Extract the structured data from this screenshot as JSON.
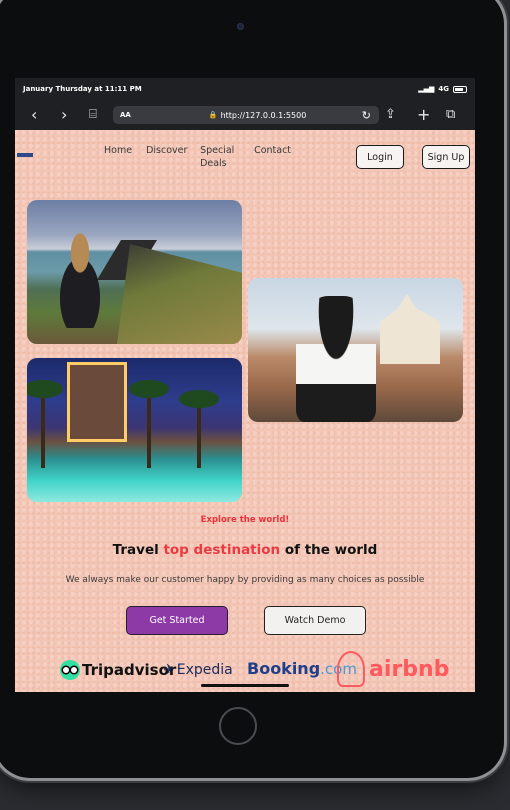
{
  "status_bar": {
    "datetime": "January Thursday at 11:11 PM",
    "signal": "4G"
  },
  "browser": {
    "text_size_label": "AA",
    "url": "http://127.0.0.1:5500",
    "icons": [
      "back-icon",
      "forward-icon",
      "bookmarks-icon",
      "lock-icon",
      "reload-icon",
      "share-icon",
      "new-tab-icon",
      "tabs-icon"
    ]
  },
  "nav": {
    "items": [
      {
        "label": "Home"
      },
      {
        "label": "Discover"
      },
      {
        "label": "Special Deals"
      },
      {
        "label": "Contact"
      }
    ],
    "login": "Login",
    "signup": "Sign Up"
  },
  "hero": {
    "tagline": "Explore the world!",
    "headline_prefix": "Travel ",
    "headline_accent": "top destination",
    "headline_suffix": " of the world",
    "subtitle": "We always make our customer happy by providing as many choices as possible",
    "primary_cta": "Get Started",
    "secondary_cta": "Watch Demo"
  },
  "partners": {
    "tripadvisor": "Tripadvisor",
    "expedia": "Expedia",
    "booking_main": "Booking",
    "booking_suffix": ".com",
    "airbnb": "airbnb"
  },
  "colors": {
    "accent_red": "#e8313b",
    "primary_purple": "#8e3aa6",
    "page_bg": "#f2c5b5"
  }
}
